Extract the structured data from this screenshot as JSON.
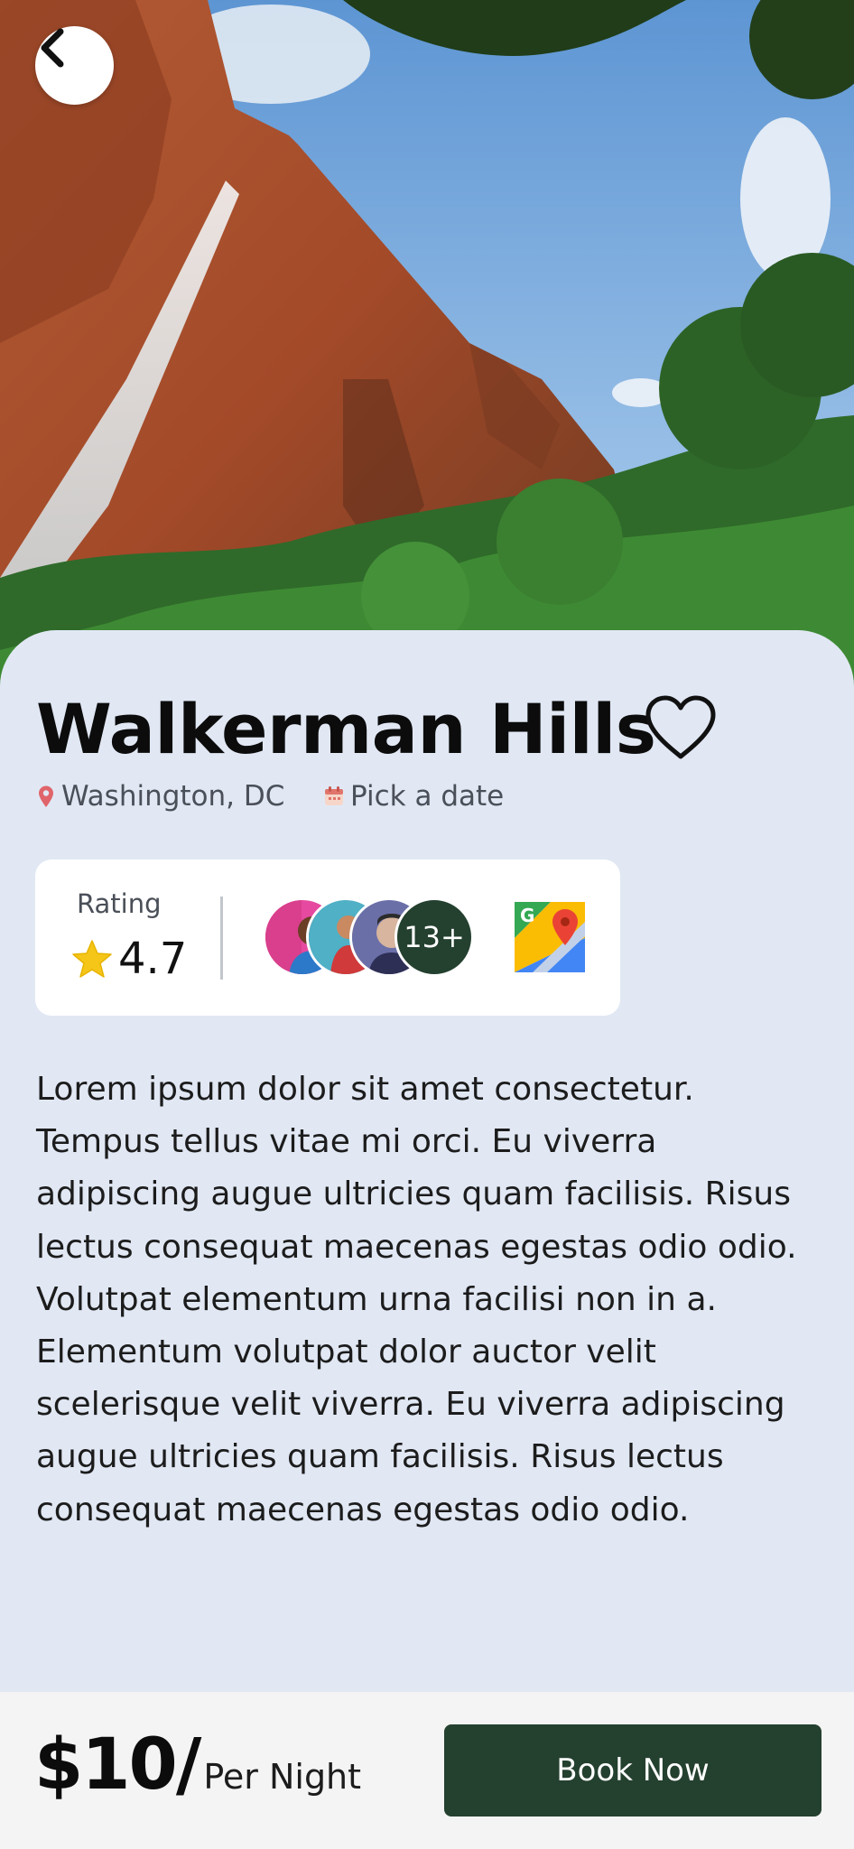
{
  "header": {
    "back_icon": "chevron-left-icon",
    "favorite_icon": "heart-outline-icon"
  },
  "place": {
    "title": "Walkerman Hills",
    "location": "Washington, DC",
    "date_label": "Pick a date"
  },
  "rating_card": {
    "label": "Rating",
    "value": "4.7",
    "visitors_more": "13+",
    "maps_icon": "google-maps-icon"
  },
  "description": "Lorem ipsum dolor sit amet consectetur. Tempus tellus vitae mi orci. Eu viverra adipiscing augue ultricies quam facilisis. Risus lectus consequat maecenas egestas odio odio. Volutpat elementum urna facilisi non in a. Elementum volutpat dolor auctor velit scelerisque velit viverra. Eu viverra adipiscing augue ultricies quam facilisis. Risus lectus consequat maecenas egestas odio odio.",
  "booking": {
    "price": "$10/",
    "price_unit": "Per Night",
    "book_label": "Book Now"
  },
  "colors": {
    "accent": "#24402f",
    "sheet_bg": "#e1e8f4",
    "bar_bg": "#f4f4f4",
    "star": "#f5c518",
    "pin": "#e0656b"
  }
}
